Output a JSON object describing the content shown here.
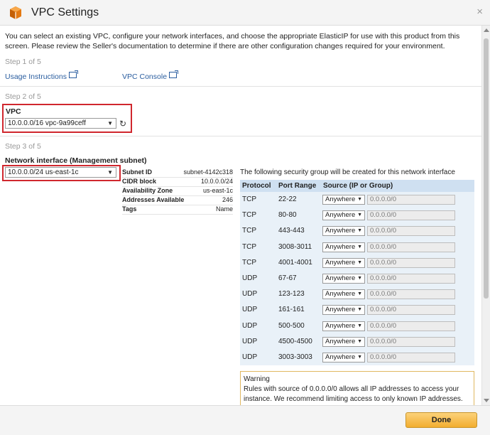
{
  "dialog": {
    "title": "VPC Settings",
    "close_icon": "×",
    "intro": "You can select an existing VPC, configure your network interfaces, and choose the appropriate ElasticIP for use with this product from this screen. Please review the Seller's documentation to determine if there are other configuration changes required for your environment."
  },
  "step1": {
    "label": "Step 1 of 5",
    "usage_link": "Usage Instructions",
    "console_link": "VPC Console"
  },
  "step2": {
    "label": "Step 2 of 5",
    "vpc_label": "VPC",
    "vpc_value": "10.0.0.0/16 vpc-9a99ceff"
  },
  "step3": {
    "label": "Step 3 of 5",
    "ni_label": "Network interface (Management subnet)",
    "subnet_value": "10.0.0.0/24 us-east-1c",
    "details": [
      {
        "key": "Subnet ID",
        "value": "subnet-4142c318"
      },
      {
        "key": "CIDR block",
        "value": "10.0.0.0/24"
      },
      {
        "key": "Availability Zone",
        "value": "us-east-1c"
      },
      {
        "key": "Addresses Available",
        "value": "246"
      },
      {
        "key": "Tags",
        "value": "Name"
      }
    ]
  },
  "security_group": {
    "caption": "The following security group will be created for this network interface",
    "headers": {
      "protocol": "Protocol",
      "port": "Port Range",
      "source": "Source (IP or Group)"
    },
    "rows": [
      {
        "protocol": "TCP",
        "port": "22-22",
        "source": "Anywhere",
        "cidr": "0.0.0.0/0"
      },
      {
        "protocol": "TCP",
        "port": "80-80",
        "source": "Anywhere",
        "cidr": "0.0.0.0/0"
      },
      {
        "protocol": "TCP",
        "port": "443-443",
        "source": "Anywhere",
        "cidr": "0.0.0.0/0"
      },
      {
        "protocol": "TCP",
        "port": "3008-3011",
        "source": "Anywhere",
        "cidr": "0.0.0.0/0"
      },
      {
        "protocol": "TCP",
        "port": "4001-4001",
        "source": "Anywhere",
        "cidr": "0.0.0.0/0"
      },
      {
        "protocol": "UDP",
        "port": "67-67",
        "source": "Anywhere",
        "cidr": "0.0.0.0/0"
      },
      {
        "protocol": "UDP",
        "port": "123-123",
        "source": "Anywhere",
        "cidr": "0.0.0.0/0"
      },
      {
        "protocol": "UDP",
        "port": "161-161",
        "source": "Anywhere",
        "cidr": "0.0.0.0/0"
      },
      {
        "protocol": "UDP",
        "port": "500-500",
        "source": "Anywhere",
        "cidr": "0.0.0.0/0"
      },
      {
        "protocol": "UDP",
        "port": "4500-4500",
        "source": "Anywhere",
        "cidr": "0.0.0.0/0"
      },
      {
        "protocol": "UDP",
        "port": "3003-3003",
        "source": "Anywhere",
        "cidr": "0.0.0.0/0"
      }
    ]
  },
  "warning": {
    "title": "Warning",
    "text": "Rules with source of 0.0.0.0/0 allows all IP addresses to access your instance. We recommend limiting access to only known IP addresses."
  },
  "footer": {
    "done_label": "Done"
  },
  "icons": {
    "app": "aws-box-icon",
    "external": "external-link-icon",
    "refresh": "refresh-icon",
    "dropdown": "chevron-down-icon"
  },
  "colors": {
    "highlight": "#d0272e",
    "accent": "#f2ad2f",
    "table_header": "#cfe0f1",
    "link": "#2a5d9f"
  }
}
